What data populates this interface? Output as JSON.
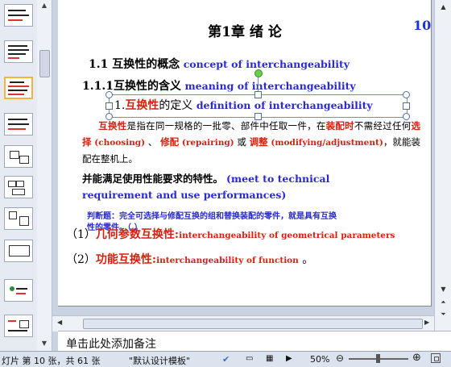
{
  "thumbnails": [
    {
      "index": 1,
      "active": false
    },
    {
      "index": 2,
      "active": false
    },
    {
      "index": 3,
      "active": true
    },
    {
      "index": 4,
      "active": false
    },
    {
      "index": 5,
      "active": false
    },
    {
      "index": 6,
      "active": false
    },
    {
      "index": 7,
      "active": false
    },
    {
      "index": 8,
      "active": false
    },
    {
      "index": 9,
      "active": false
    },
    {
      "index": 10,
      "active": false
    }
  ],
  "slide": {
    "title": "第1章  绪  论",
    "page_number": "10",
    "h1": {
      "cn": "1.1 互换性的概念",
      "en": "concept of  interchangeability"
    },
    "h2": {
      "cn": "1.1.1互换性的含义",
      "en": "meaning of interchangeability"
    },
    "h3": {
      "prefix": "1.",
      "red": "互换性",
      "cn_rest": "的定义",
      "en": "definition of interchangeability"
    },
    "para1": {
      "t1": "互换性",
      "t2": "是指在同一规格的一批零、部件中任取一件，在",
      "t3": "装配时",
      "t4": "不需经过任何",
      "t5": "选择",
      "t6": "(choosing)",
      "t7": "、",
      "t8": "修配",
      "t9": "(repairing)",
      "t10": "或",
      "t11": "调整",
      "t12": "(modifying/adjustment)",
      "t13": "，就能装配在整机上。"
    },
    "para2": {
      "cn": "并能满足使用性能要求的特性。",
      "en1": "(meet  to  technical",
      "en2": "requirement and use performances)"
    },
    "overlay1": "判断题：完全可选择与修配互换的组和替换装配的零件，就是具有互换",
    "overlay2": "性的零件。（  ）",
    "item1": {
      "num": "（1）",
      "cn": "几何参数互换性:",
      "en": "interchangeability of geometrical parameters"
    },
    "item2": {
      "num": "（2）",
      "cn": "功能互换性:",
      "en": "interchangeability of function",
      "end": "。"
    }
  },
  "notes": {
    "placeholder": "单击此处添加备注"
  },
  "status": {
    "slide_info": "灯片 第 10 张，共 61 张",
    "theme": "\"默认设计模板\"",
    "language_icon": "check-icon",
    "zoom": "50%"
  }
}
